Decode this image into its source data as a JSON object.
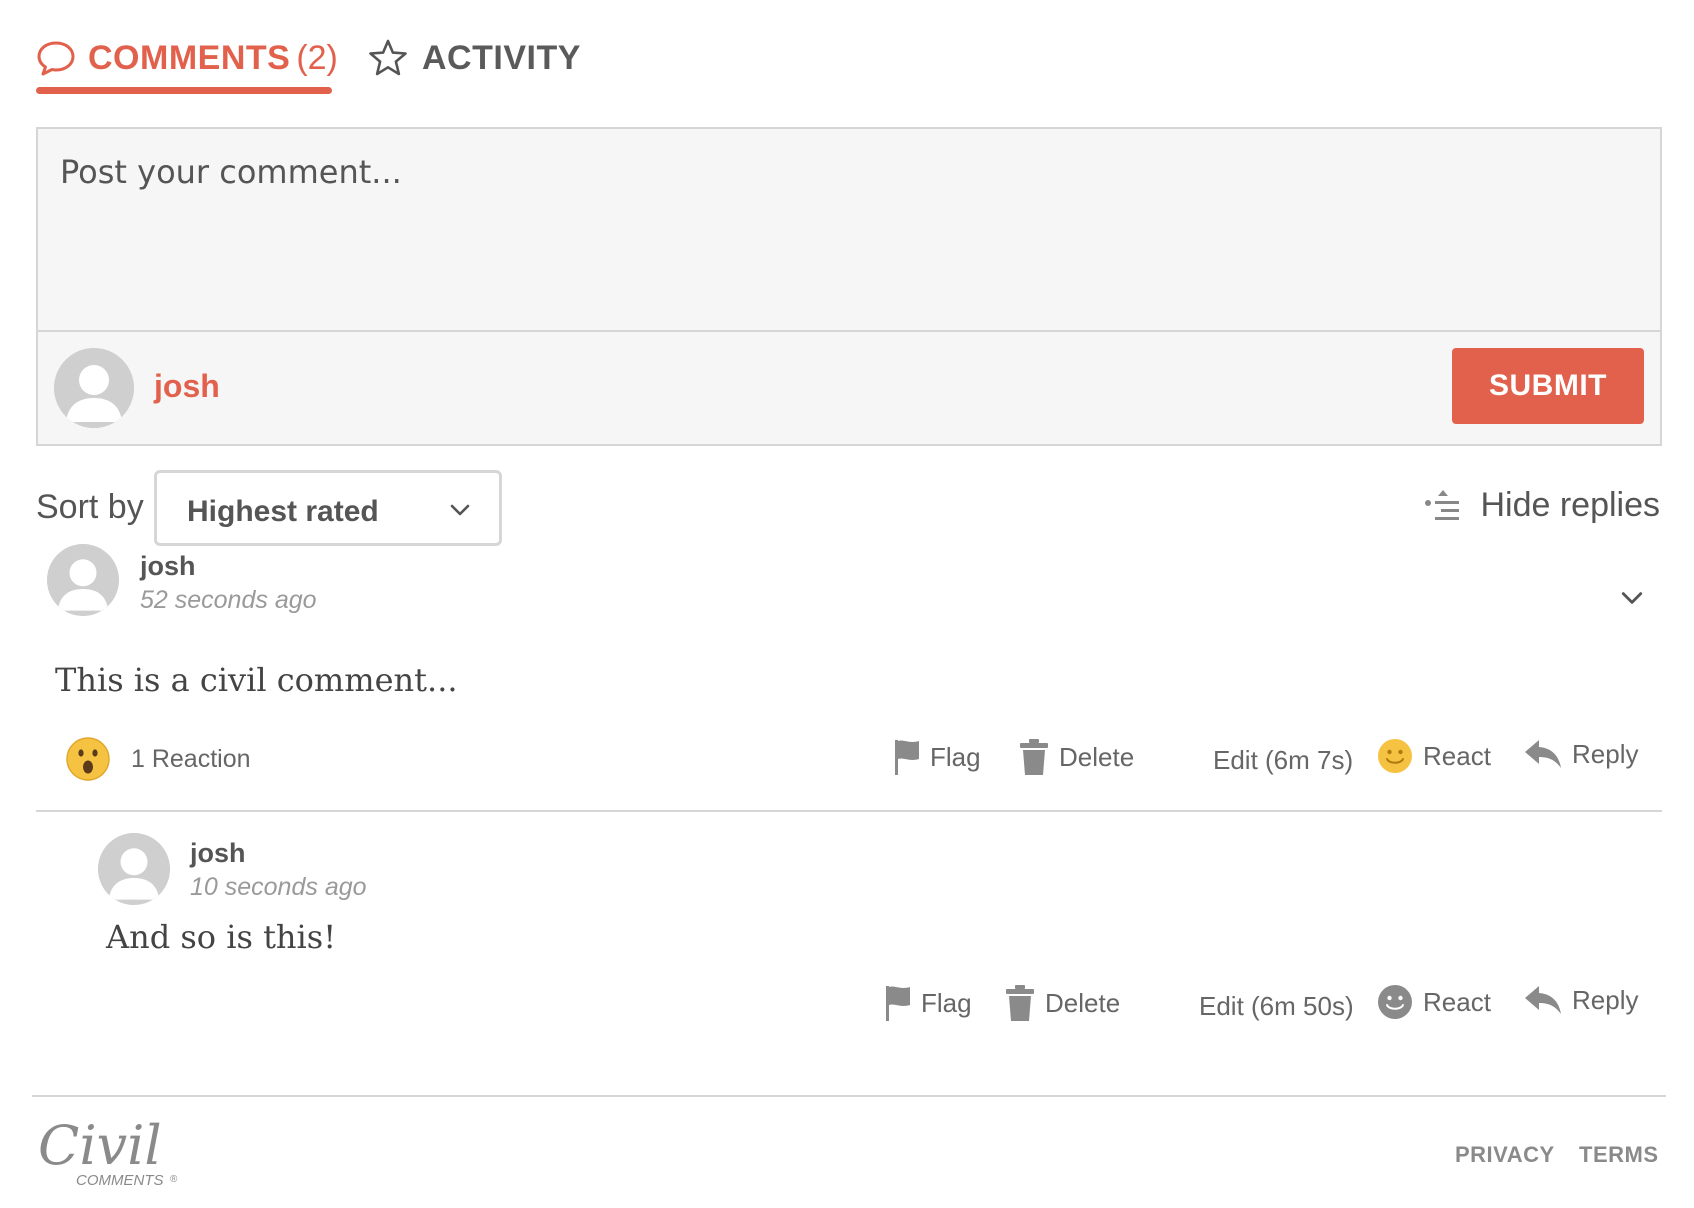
{
  "tabs": {
    "comments": {
      "label": "COMMENTS",
      "count": "(2)"
    },
    "activity": {
      "label": "ACTIVITY"
    }
  },
  "composer": {
    "placeholder": "Post your comment...",
    "username": "josh",
    "submit_label": "SUBMIT"
  },
  "sort": {
    "label": "Sort by",
    "selected": "Highest rated"
  },
  "hide_replies_label": "Hide replies",
  "comments": [
    {
      "username": "josh",
      "time": "52 seconds ago",
      "body": "This is a civil comment...",
      "reaction_summary": "1 Reaction",
      "actions": {
        "flag": "Flag",
        "delete": "Delete",
        "edit": "Edit (6m 7s)",
        "react": "React",
        "reply": "Reply"
      }
    },
    {
      "username": "josh",
      "time": "10 seconds ago",
      "body": "And so is this!",
      "actions": {
        "flag": "Flag",
        "delete": "Delete",
        "edit": "Edit (6m 50s)",
        "react": "React",
        "reply": "Reply"
      }
    }
  ],
  "footer": {
    "logo_main": "Civil",
    "logo_sub": "COMMENTS",
    "privacy": "PRIVACY",
    "terms": "TERMS"
  },
  "colors": {
    "accent": "#e2614c",
    "text": "#555555",
    "muted": "#9a9a9a",
    "border": "#d6d6d6",
    "composer_bg": "#f6f6f6",
    "react_yellow": "#f5c242"
  },
  "icons": [
    "speech-bubble-icon",
    "star-icon",
    "avatar-icon",
    "chevron-down-icon",
    "hide-replies-icon",
    "surprised-emoji-icon",
    "flag-icon",
    "trash-icon",
    "smiley-icon",
    "reply-arrow-icon"
  ]
}
